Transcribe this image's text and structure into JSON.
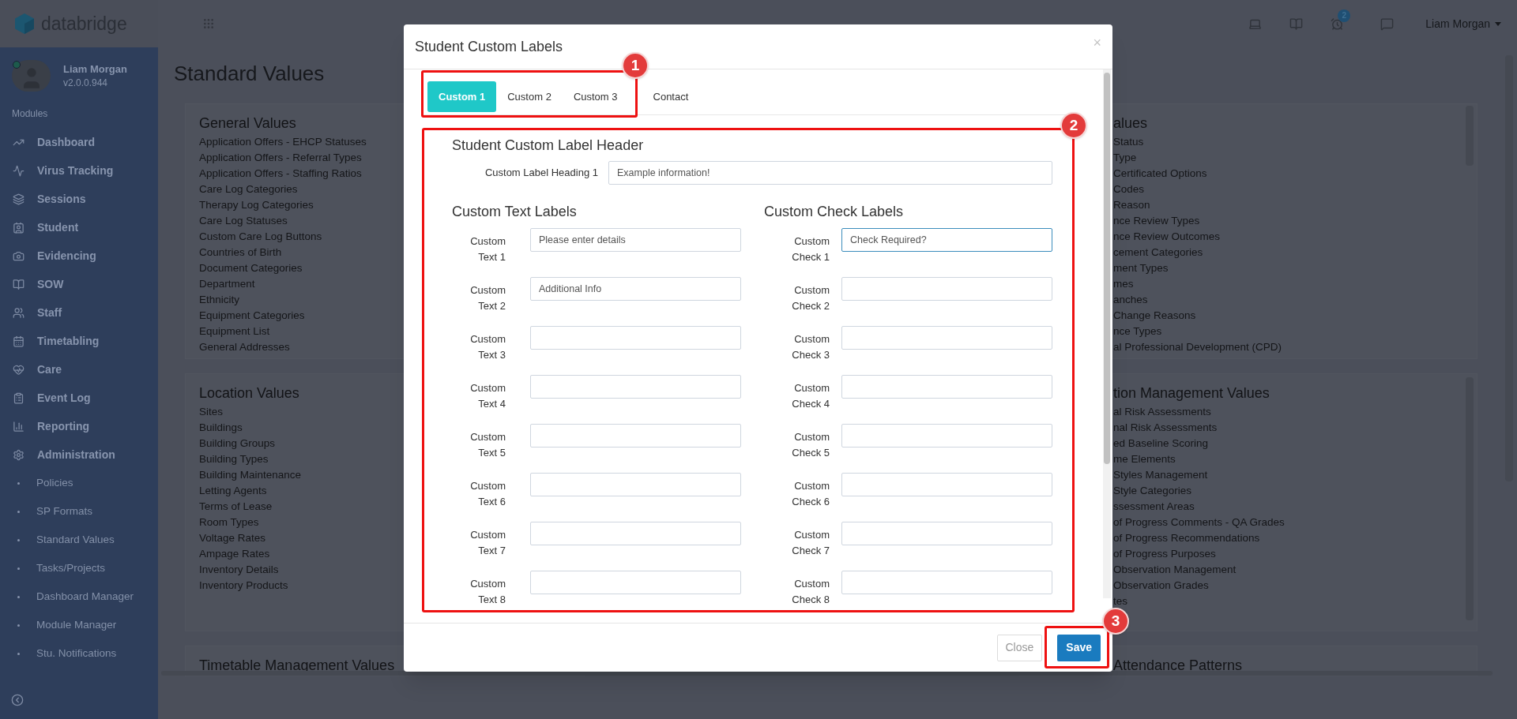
{
  "topbar": {
    "logo": "databridge",
    "notification_count": "2",
    "user_menu": "Liam Morgan"
  },
  "sidebar": {
    "user": {
      "name": "Liam Morgan",
      "version": "v2.0.0.944",
      "online": true
    },
    "section_label": "Modules",
    "items": [
      {
        "label": "Dashboard"
      },
      {
        "label": "Virus Tracking"
      },
      {
        "label": "Sessions"
      },
      {
        "label": "Student"
      },
      {
        "label": "Evidencing"
      },
      {
        "label": "SOW"
      },
      {
        "label": "Staff"
      },
      {
        "label": "Timetabling"
      },
      {
        "label": "Care"
      },
      {
        "label": "Event Log"
      },
      {
        "label": "Reporting"
      },
      {
        "label": "Administration",
        "children": [
          {
            "label": "Policies"
          },
          {
            "label": "SP Formats"
          },
          {
            "label": "Standard Values"
          },
          {
            "label": "Tasks/Projects"
          },
          {
            "label": "Dashboard Manager"
          },
          {
            "label": "Module Manager"
          },
          {
            "label": "Stu. Notifications"
          }
        ]
      }
    ]
  },
  "page": {
    "title": "Standard Values",
    "left_cards": [
      {
        "heading": "General Values",
        "items": [
          "Application Offers - EHCP Statuses",
          "Application Offers - Referral Types",
          "Application Offers - Staffing Ratios",
          "Care Log Categories",
          "Therapy Log Categories",
          "Care Log Statuses",
          "Custom Care Log Buttons",
          "Countries of Birth",
          "Document Categories",
          "Department",
          "Ethnicity",
          "Equipment Categories",
          "Equipment List",
          "General Addresses"
        ]
      },
      {
        "heading": "Location Values",
        "items": [
          "Sites",
          "Buildings",
          "Building Groups",
          "Building Types",
          "Building Maintenance",
          "Letting Agents",
          "Terms of Lease",
          "Room Types",
          "Voltage Rates",
          "Ampage Rates",
          "Inventory Details",
          "Inventory Products"
        ]
      },
      {
        "heading": "Timetable Management Values"
      }
    ],
    "right_cards": [
      {
        "heading": "alues",
        "items": [
          "Status",
          "Type",
          "Certificated Options",
          "Codes",
          "Reason",
          "nce Review Types",
          "nce Review Outcomes",
          "cement Categories",
          "ment Types",
          "mes",
          "anches",
          "Change Reasons",
          "nce Types",
          "al Professional Development (CPD)"
        ]
      },
      {
        "heading": "tion Management Values",
        "items": [
          "al Risk Assessments",
          "nal Risk Assessments",
          "ed Baseline Scoring",
          "me Elements",
          "Styles Management",
          "Style Categories",
          "ssessment Areas",
          "of Progress Comments - QA Grades",
          "of Progress Recommendations",
          "of Progress Purposes",
          "Observation Management",
          "Observation Grades",
          "tes"
        ]
      },
      {
        "heading": "Attendance Patterns"
      }
    ]
  },
  "modal": {
    "title": "Student Custom Labels",
    "close_glyph": "×",
    "tabs": [
      {
        "label": "Custom 1",
        "selected": true
      },
      {
        "label": "Custom 2",
        "selected": false
      },
      {
        "label": "Custom 3",
        "selected": false
      },
      {
        "label": "Contact",
        "selected": false
      }
    ],
    "header_section": {
      "heading": "Student Custom Label Header",
      "fields": [
        {
          "label": "Custom Label Heading 1",
          "value": "Example information!",
          "focused": false
        }
      ]
    },
    "text_section": {
      "heading": "Custom Text Labels",
      "fields": [
        {
          "label": "Custom Text 1",
          "value": "Please enter details",
          "focused": false
        },
        {
          "label": "Custom Text 2",
          "value": "Additional Info",
          "focused": false
        },
        {
          "label": "Custom Text 3",
          "focused": false
        },
        {
          "label": "Custom Text 4",
          "focused": false
        },
        {
          "label": "Custom Text 5",
          "focused": false
        },
        {
          "label": "Custom Text 6",
          "focused": false
        },
        {
          "label": "Custom Text 7",
          "focused": false
        },
        {
          "label": "Custom Text 8",
          "focused": false
        }
      ]
    },
    "check_section": {
      "heading": "Custom Check Labels",
      "fields": [
        {
          "label": "Custom Check 1",
          "value": "Check Required?",
          "focused": true
        },
        {
          "label": "Custom Check 2",
          "focused": false
        },
        {
          "label": "Custom Check 3",
          "focused": false
        },
        {
          "label": "Custom Check 4",
          "focused": false
        },
        {
          "label": "Custom Check 5",
          "focused": false
        },
        {
          "label": "Custom Check 6",
          "focused": false
        },
        {
          "label": "Custom Check 7",
          "focused": false
        },
        {
          "label": "Custom Check 8",
          "focused": false
        }
      ]
    },
    "buttons": {
      "close": "Close",
      "save": "Save"
    }
  },
  "callouts": [
    {
      "number": "1"
    },
    {
      "number": "2"
    },
    {
      "number": "3"
    }
  ]
}
